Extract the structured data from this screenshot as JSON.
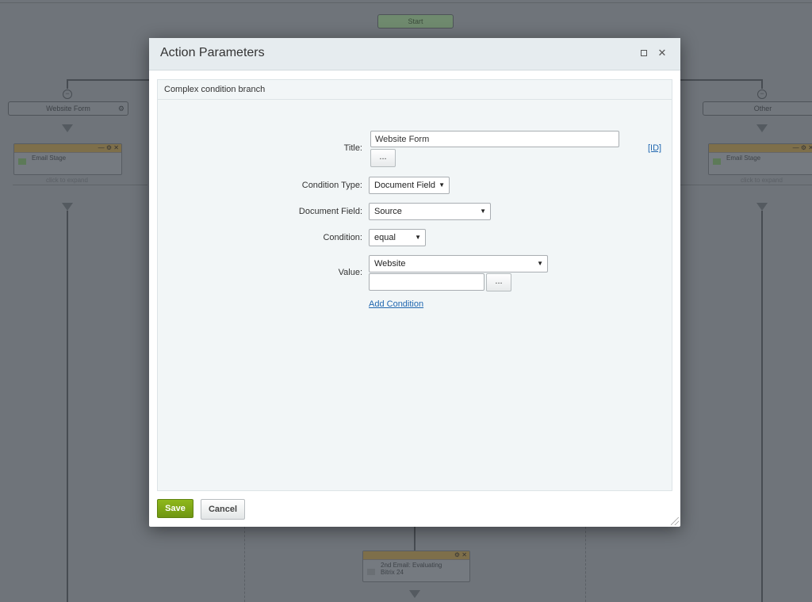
{
  "background": {
    "start_label": "Start",
    "left_branch_label": "Website Form",
    "right_branch_label": "Other",
    "activity_left_label": "Email Stage",
    "activity_right_label": "Email Stage",
    "expand_hint": "click to expand",
    "bottom_activity_label_1": "2nd Email: Evaluating",
    "bottom_activity_label_2": "Bitrix 24"
  },
  "dialog": {
    "title": "Action Parameters",
    "section_header": "Complex condition branch",
    "title_field": {
      "label": "Title:",
      "value": "Website Form",
      "id_link": "[ID]"
    },
    "ellipsis": "...",
    "condition_type": {
      "label": "Condition Type:",
      "selected": "Document Field"
    },
    "document_field": {
      "label": "Document Field:",
      "selected": "Source"
    },
    "condition": {
      "label": "Condition:",
      "selected": "equal"
    },
    "value": {
      "label": "Value:",
      "selected": "Website",
      "text_value": ""
    },
    "add_condition": "Add Condition",
    "save": "Save",
    "cancel": "Cancel"
  },
  "colors": {
    "accent_green": "#7ba616",
    "link_blue": "#2067b0",
    "overlay": "#6f747a"
  }
}
